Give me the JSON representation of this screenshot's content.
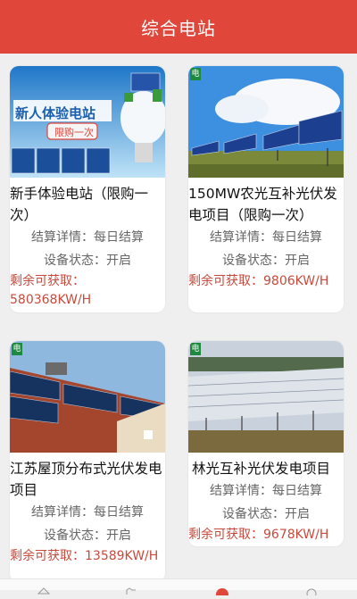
{
  "header": {
    "title": "综合电站"
  },
  "cards": [
    {
      "banner_title": "新人体验电站",
      "banner_sub": "限购一次",
      "title": "新手体验电站（限购一次）",
      "settle": "结算详情：每日结算",
      "status": "设备状态：开启",
      "remain_label": "剩余可获取：",
      "remain_value": "580368KW/H"
    },
    {
      "title": "150MW农光互补光伏发电项目（限购一次）",
      "settle": "结算详情：每日结算",
      "status": "设备状态：开启",
      "remain_label": "剩余可获取：",
      "remain_value": "9806KW/H"
    },
    {
      "title": "江苏屋顶分布式光伏发电项目",
      "settle": "结算详情：每日结算",
      "status": "设备状态：开启",
      "remain_label": "剩余可获取：",
      "remain_value": "13589KW/H"
    },
    {
      "title": "林光互补光伏发电项目",
      "settle": "结算详情：每日结算",
      "status": "设备状态：开启",
      "remain_label": "剩余可获取：",
      "remain_value": "9678KW/H"
    }
  ],
  "logo_text": "电",
  "colors": {
    "accent": "#e0463a",
    "remain": "#c84a3c"
  },
  "tabbar_icons": [
    "home-icon",
    "hand-icon",
    "plant-icon",
    "user-icon"
  ]
}
